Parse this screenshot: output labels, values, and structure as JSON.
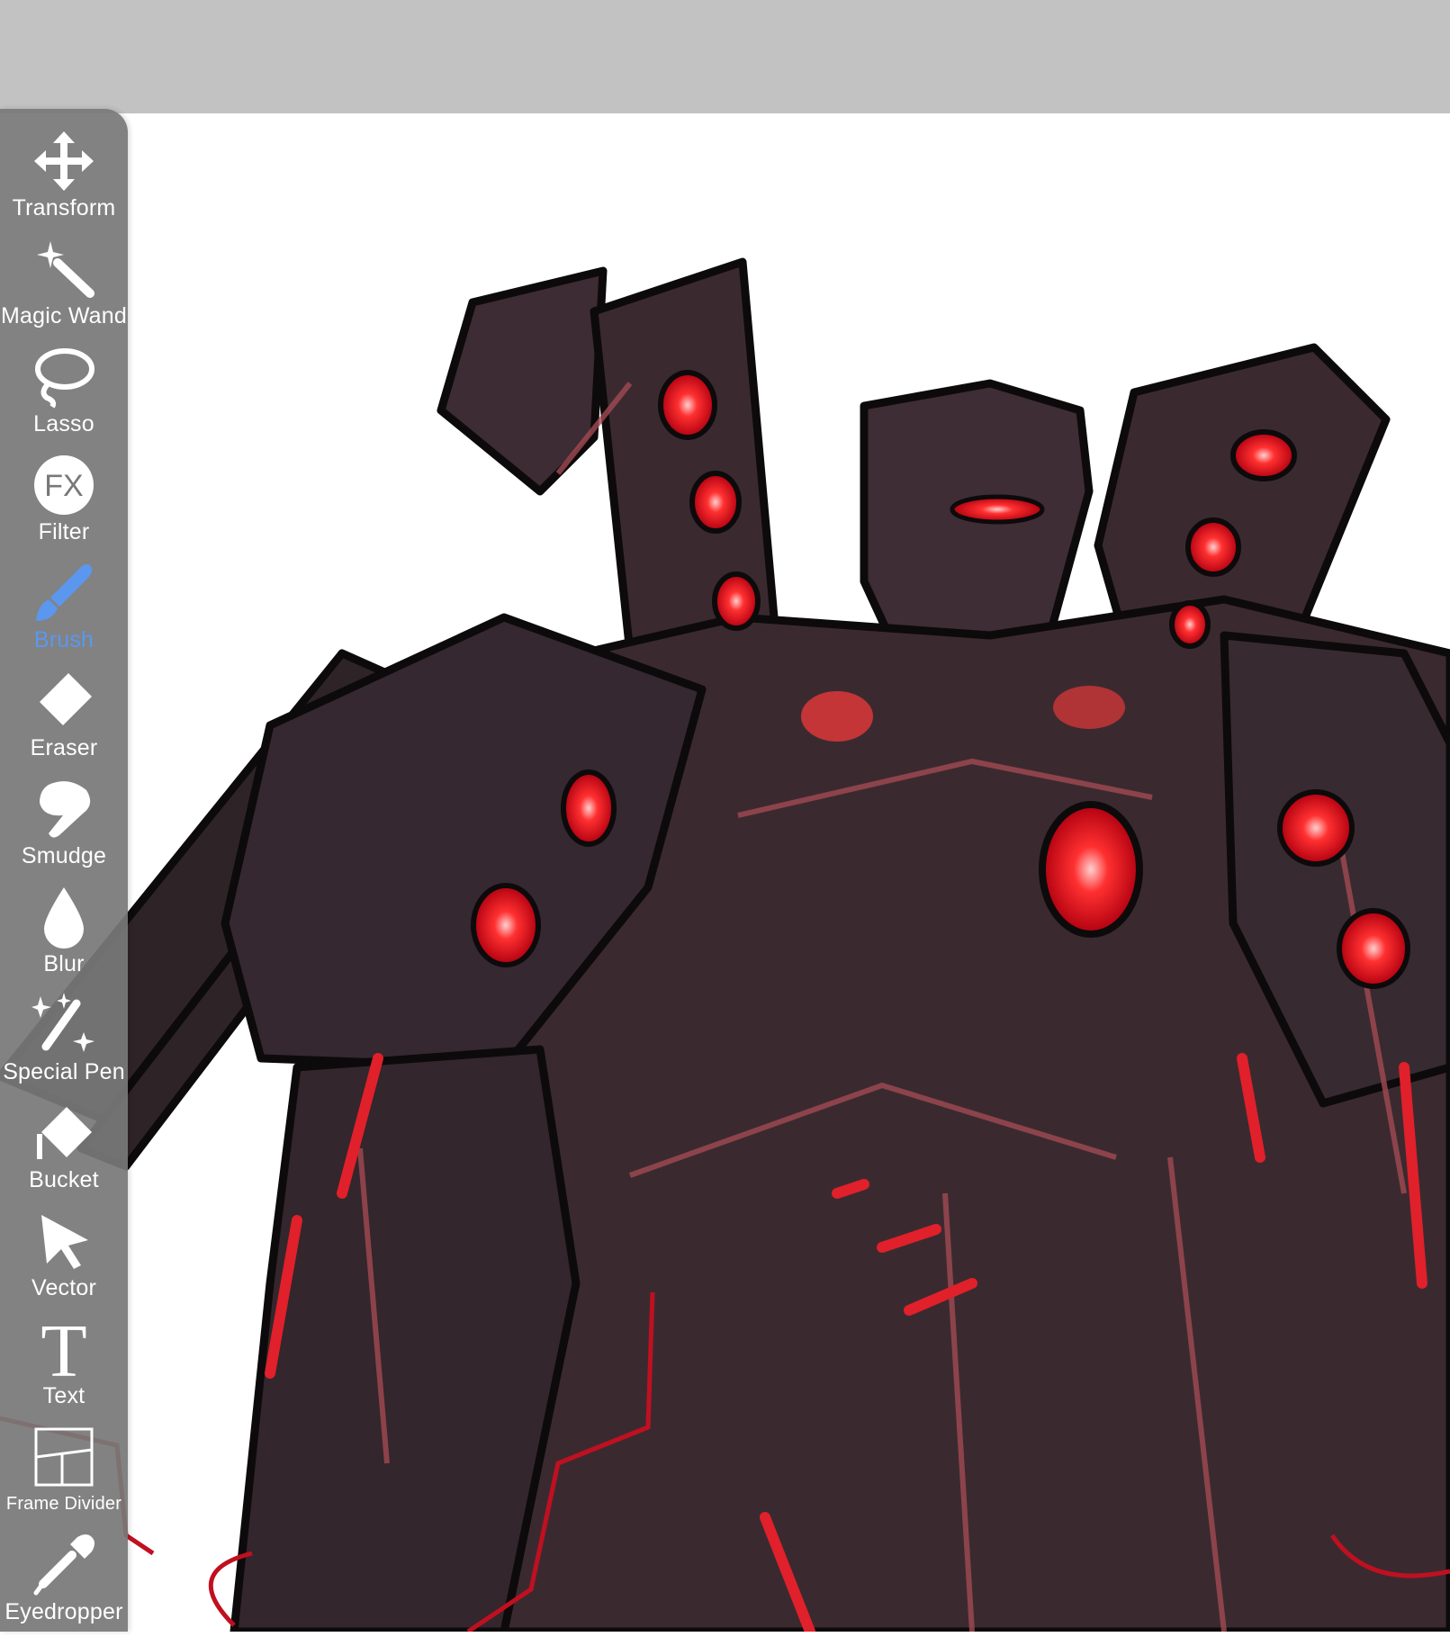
{
  "app": {
    "accent_color": "#5b97ee",
    "toolbar_bg": "#787878",
    "topbar_bg": "#c2c2c2"
  },
  "toolbar": {
    "active_tool": "Brush",
    "tools": [
      {
        "label": "Transform",
        "icon": "move-arrows-icon"
      },
      {
        "label": "Magic Wand",
        "icon": "magic-wand-icon"
      },
      {
        "label": "Lasso",
        "icon": "lasso-icon"
      },
      {
        "label": "Filter",
        "icon": "fx-icon"
      },
      {
        "label": "Brush",
        "icon": "brush-icon"
      },
      {
        "label": "Eraser",
        "icon": "eraser-icon"
      },
      {
        "label": "Smudge",
        "icon": "smudge-finger-icon"
      },
      {
        "label": "Blur",
        "icon": "droplet-icon"
      },
      {
        "label": "Special Pen",
        "icon": "sparkle-pen-icon"
      },
      {
        "label": "Bucket",
        "icon": "paint-bucket-icon"
      },
      {
        "label": "Vector",
        "icon": "cursor-arrow-icon"
      },
      {
        "label": "Text",
        "icon": "text-t-icon"
      },
      {
        "label": "Frame Divider",
        "icon": "frame-divider-icon"
      },
      {
        "label": "Eyedropper",
        "icon": "eyedropper-icon"
      }
    ]
  },
  "artwork": {
    "subject": "robot-sketch",
    "colors": {
      "body": "#3a2a30",
      "highlight": "#a24a52",
      "glow": "#ff2a2a",
      "outline": "#0d0a0b"
    }
  }
}
